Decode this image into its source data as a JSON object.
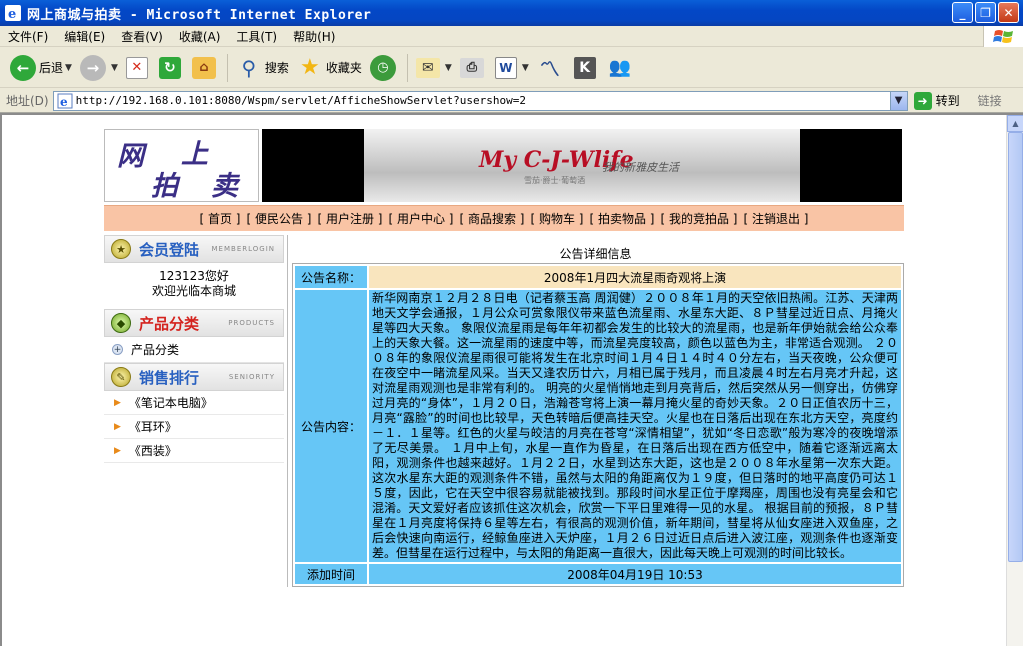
{
  "window": {
    "title": "网上商城与拍卖 - Microsoft Internet Explorer",
    "buttons": [
      "_",
      "❐",
      "✕"
    ]
  },
  "menubar": [
    "文件(F)",
    "编辑(E)",
    "查看(V)",
    "收藏(A)",
    "工具(T)",
    "帮助(H)"
  ],
  "toolbar": {
    "back": "后退",
    "search": "搜索",
    "favorites": "收藏夹"
  },
  "address": {
    "label": "地址(D)",
    "url": "http://192.168.0.101:8080/Wspm/servlet/AfficheShowServlet?usershow=2",
    "go": "转到",
    "links": "链接"
  },
  "site": {
    "logo": [
      "网",
      "上",
      "拍",
      "卖"
    ],
    "banner_tagline": "My C-J-Wlife",
    "banner_sub": "我的新雅皮生活",
    "banner_sub2": "雪茄·爵士·葡萄酒",
    "nav": [
      "[ 首页 ]",
      "[ 便民公告 ]",
      "[ 用户注册 ]",
      "[ 用户中心 ]",
      "[ 商品搜索 ]",
      "[ 购物车 ]",
      "[ 拍卖物品 ]",
      "[ 我的竞拍品 ]",
      "[ 注销退出 ]"
    ]
  },
  "sidebar": {
    "member": {
      "title": "会员登陆",
      "en": "MEMBERLOGIN",
      "greeting": "123123您好",
      "welcome": "欢迎光临本商城"
    },
    "category": {
      "title": "产品分类",
      "en": "PRODUCTS",
      "item": "产品分类"
    },
    "ranking": {
      "title": "销售排行",
      "en": "SENIORITY",
      "items": [
        "《笔记本电脑》",
        "《耳环》",
        "《西装》"
      ]
    }
  },
  "notice": {
    "heading": "公告详细信息",
    "name_label": "公告名称：",
    "name_value": "2008年1月四大流星雨奇观将上演",
    "content_label": "公告内容：",
    "content": "新华网南京１２月２８日电（记者蔡玉高 周润健）２００８年１月的天空依旧热闹。江苏、天津两地天文学会通报，１月公众可赏象限仪带来蓝色流星雨、水星东大距、８Ｐ彗星过近日点、月掩火星等四大天象。 象限仪流星雨是每年年初都会发生的比较大的流星雨，也是新年伊始就会给公众奉上的天象大餐。这一流星雨的速度中等，而流星亮度较高，颜色以蓝色为主，非常适合观测。 ２００８年的象限仪流星雨很可能将发生在北京时间１月４日１４时４０分左右，当天夜晚，公众便可在夜空中一睹流星风采。当天又逢农历廿六，月相已属于残月，而且凌晨４时左右月亮才升起，这对流星雨观测也是非常有利的。 明亮的火星悄悄地走到月亮背后，然后突然从另一侧穿出，仿佛穿过月亮的“身体”，１月２０日，浩瀚苍穹将上演一幕月掩火星的奇妙天象。２０日正值农历十三，月亮“露脸”的时间也比较早，天色转暗后便高挂天空。火星也在日落后出现在东北方天空，亮度约－１．１星等。红色的火星与皎洁的月亮在苍穹“深情相望”，犹如“冬日恋歌”般为寒冷的夜晚增添了无尽美景。 １月中上旬，水星一直作为昏星，在日落后出现在西方低空中，随着它逐渐远离太阳，观测条件也越来越好。１月２２日，水星到达东大距，这也是２００８年水星第一次东大距。 这次水星东大距的观测条件不错，虽然与太阳的角距离仅为１９度，但日落时的地平高度仍可达１５度，因此，它在天空中很容易就能被找到。那段时间水星正位于摩羯座，周围也没有亮星会和它混淆。天文爱好者应该抓住这次机会，欣赏一下平日里难得一见的水星。 根据目前的预报，８Ｐ彗星在１月亮度将保持６星等左右，有很高的观测价值，新年期间，彗星将从仙女座进入双鱼座，之后会快速向南运行，经鲸鱼座进入天炉座，１月２６日过近日点后进入波江座，观测条件也逐渐变差。但彗星在运行过程中，与太阳的角距离一直很大，因此每天晚上可观测的时间比较长。",
    "time_label": "添加时间",
    "time_value": "2008年04月19日 10:53"
  },
  "colors": {
    "nav_bg": "#F9C4A5",
    "label_bg": "#66C6F6",
    "name_bg": "#F9E5BE"
  }
}
